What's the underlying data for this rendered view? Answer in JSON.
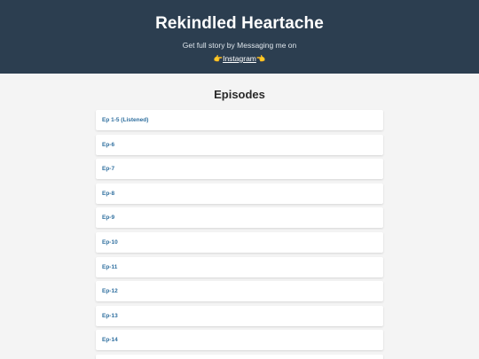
{
  "header": {
    "title": "Rekindled Heartache",
    "subtitle": "Get full story by Messaging me on",
    "link_emoji_left": "👉",
    "link_label": "Instagram",
    "link_emoji_right": "👈"
  },
  "main": {
    "section_title": "Episodes",
    "episodes": [
      {
        "label": "Ep 1-5 (Listened)"
      },
      {
        "label": "Ep-6"
      },
      {
        "label": "Ep-7"
      },
      {
        "label": "Ep-8"
      },
      {
        "label": "Ep-9"
      },
      {
        "label": "Ep-10"
      },
      {
        "label": "Ep-11"
      },
      {
        "label": "Ep-12"
      },
      {
        "label": "Ep-13"
      },
      {
        "label": "Ep-14"
      },
      {
        "label": ""
      }
    ]
  },
  "colors": {
    "header_bg": "#2c3e50",
    "page_bg": "#f4f4f4",
    "link_text": "#2f6f9f"
  }
}
